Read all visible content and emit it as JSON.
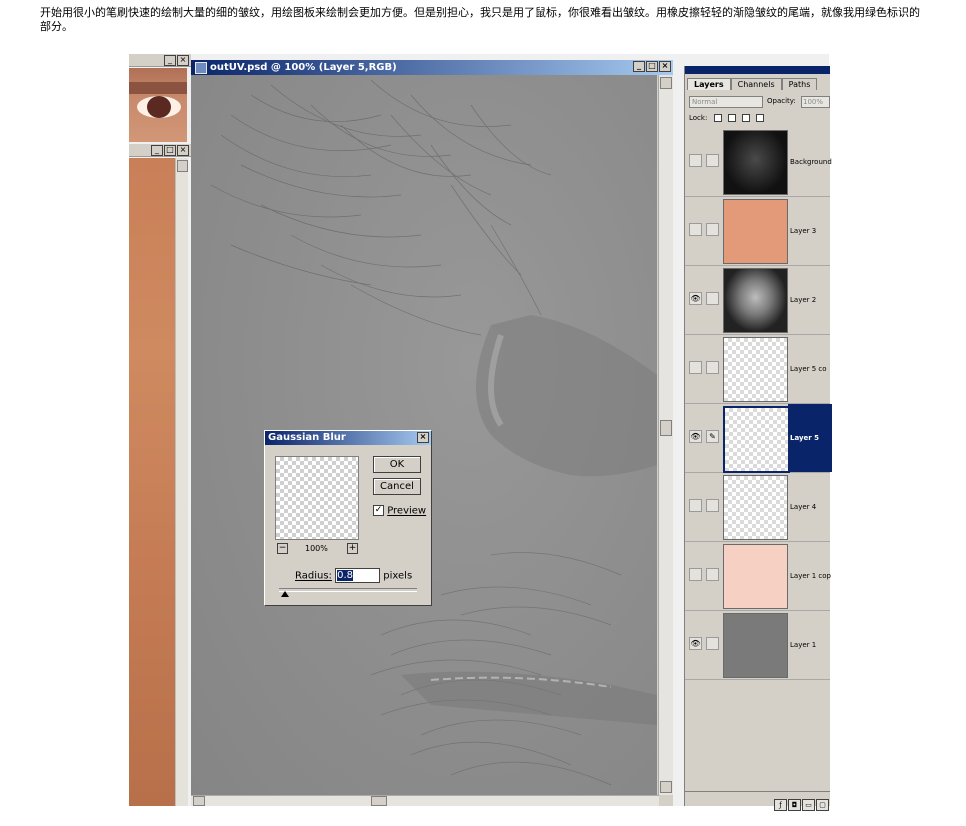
{
  "caption": "开始用很小的笔刷快速的绘制大量的细的皱纹，用绘图板来绘制会更加方便。但是别担心，我只是用了鼠标，你很难看出皱纹。用橡皮擦轻轻的渐隐皱纹的尾端，就像我用绿色标识的部分。",
  "document_window": {
    "title": "outUV.psd @ 100% (Layer 5,RGB)",
    "buttons": {
      "minimize": "_",
      "maximize": "□",
      "close": "×"
    }
  },
  "gaussian_blur": {
    "title": "Gaussian Blur",
    "close": "×",
    "ok_label": "OK",
    "cancel_label": "Cancel",
    "preview_label": "Preview",
    "preview_checked": "✓",
    "zoom_minus": "−",
    "zoom_plus": "+",
    "zoom_level": "100%",
    "radius_label": "Radius:",
    "radius_value": "0.8",
    "radius_unit": "pixels"
  },
  "layers_palette": {
    "tabs": [
      "Layers",
      "Channels",
      "Paths"
    ],
    "blend_mode": "Normal",
    "opacity_label": "Opacity:",
    "opacity_value": "100%",
    "lock_label": "Lock:",
    "layers": [
      {
        "name": "Background",
        "visible": false,
        "thumb": "dark-face",
        "selected": false
      },
      {
        "name": "Layer 3",
        "visible": false,
        "thumb": "#e39a78",
        "selected": false
      },
      {
        "name": "Layer 2",
        "visible": true,
        "thumb": "grey-face",
        "selected": false
      },
      {
        "name": "Layer 5 co",
        "visible": false,
        "thumb": "transparent",
        "selected": false
      },
      {
        "name": "Layer 5",
        "visible": true,
        "thumb": "transparent",
        "selected": true
      },
      {
        "name": "Layer 4",
        "visible": false,
        "thumb": "transparent",
        "selected": false
      },
      {
        "name": "Layer 1 cop",
        "visible": false,
        "thumb": "#f7d0c4",
        "selected": false
      },
      {
        "name": "Layer 1",
        "visible": true,
        "thumb": "#7a7a7a",
        "selected": false
      }
    ],
    "eye_icon": "👁",
    "brush_icon": "✎"
  },
  "colors": {
    "title_active": "#0a246a",
    "window_face": "#d4d0c8",
    "skin": "#c97f57"
  }
}
